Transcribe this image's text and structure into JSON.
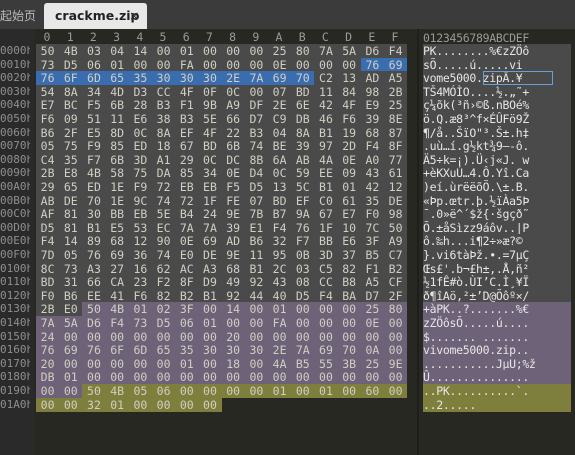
{
  "tabs": {
    "inactive_label": "起始页",
    "active_label": "crackme.zip",
    "close_glyph": "×"
  },
  "column_headers": [
    "0",
    "1",
    "2",
    "3",
    "4",
    "5",
    "6",
    "7",
    "8",
    "9",
    "A",
    "B",
    "C",
    "D",
    "E",
    "F"
  ],
  "ascii_header": "0123456789ABCDEF",
  "rows": [
    {
      "offset": "0000h",
      "hex": [
        "50",
        "4B",
        "03",
        "04",
        "14",
        "00",
        "01",
        "00",
        "00",
        "00",
        "25",
        "80",
        "7A",
        "5A",
        "D6",
        "F4"
      ],
      "ascii": "PK........%€zZÖô"
    },
    {
      "offset": "0010h",
      "hex": [
        "73",
        "D5",
        "06",
        "01",
        "00",
        "00",
        "FA",
        "00",
        "00",
        "00",
        "0E",
        "00",
        "00",
        "00",
        "76",
        "69"
      ],
      "ascii": "sÕ.....ú.....vi"
    },
    {
      "offset": "0020h",
      "hex": [
        "76",
        "6F",
        "6D",
        "65",
        "35",
        "30",
        "30",
        "30",
        "2E",
        "7A",
        "69",
        "70",
        "C2",
        "13",
        "AD",
        "A5"
      ],
      "ascii": "vome5000.zipÂ.­¥"
    },
    {
      "offset": "0030h",
      "hex": [
        "54",
        "8A",
        "34",
        "4D",
        "D3",
        "CC",
        "4F",
        "0F",
        "0C",
        "00",
        "07",
        "BD",
        "11",
        "84",
        "98",
        "2B"
      ],
      "ascii": "TŠ4MÓÌO....½.„˜+"
    },
    {
      "offset": "0040h",
      "hex": [
        "E7",
        "BC",
        "F5",
        "6B",
        "28",
        "B3",
        "F1",
        "9B",
        "A9",
        "DF",
        "2E",
        "6E",
        "42",
        "4F",
        "E9",
        "25"
      ],
      "ascii": "ç¼õk(³ñ›©ß.nBOé%"
    },
    {
      "offset": "0050h",
      "hex": [
        "F6",
        "09",
        "51",
        "11",
        "E6",
        "38",
        "B3",
        "5E",
        "66",
        "D7",
        "C9",
        "DB",
        "46",
        "F6",
        "39",
        "8E"
      ],
      "ascii": "ö.Q.æ8³^f×ÉÛFö9Ž"
    },
    {
      "offset": "0060h",
      "hex": [
        "B6",
        "2F",
        "E5",
        "8D",
        "0C",
        "8A",
        "EF",
        "4F",
        "22",
        "B3",
        "04",
        "8A",
        "B1",
        "19",
        "68",
        "87"
      ],
      "ascii": "¶/å..ŠïO\"³.Š±.h‡"
    },
    {
      "offset": "0070h",
      "hex": [
        "05",
        "75",
        "F9",
        "85",
        "ED",
        "18",
        "67",
        "BD",
        "6B",
        "74",
        "BE",
        "39",
        "97",
        "2D",
        "F4",
        "8F"
      ],
      "ascii": ".uù…í.g½kt¾9—-ô."
    },
    {
      "offset": "0080h",
      "hex": [
        "C4",
        "35",
        "F7",
        "6B",
        "3D",
        "A1",
        "29",
        "0C",
        "DC",
        "8B",
        "6A",
        "AB",
        "4A",
        "0E",
        "A0",
        "77"
      ],
      "ascii": "Ä5÷k=¡).Ü‹j«J. w"
    },
    {
      "offset": "0090h",
      "hex": [
        "2B",
        "E8",
        "4B",
        "58",
        "75",
        "DA",
        "85",
        "34",
        "0E",
        "D4",
        "0C",
        "59",
        "EE",
        "09",
        "43",
        "61"
      ],
      "ascii": "+èKXuÚ…4.Ô.Yî.Ca"
    },
    {
      "offset": "00A0h",
      "hex": [
        "29",
        "65",
        "ED",
        "1E",
        "F9",
        "72",
        "EB",
        "EB",
        "F5",
        "D5",
        "13",
        "5C",
        "B1",
        "01",
        "42",
        "12"
      ],
      "ascii": ")eí.ùrëëõÕ.\\±.B."
    },
    {
      "offset": "00B0h",
      "hex": [
        "AB",
        "DE",
        "70",
        "1E",
        "9C",
        "74",
        "72",
        "1F",
        "FE",
        "07",
        "BD",
        "EF",
        "C0",
        "61",
        "35",
        "DE"
      ],
      "ascii": "«Þp.œtr.þ.½ïÀa5Þ"
    },
    {
      "offset": "00C0h",
      "hex": [
        "AF",
        "81",
        "30",
        "BB",
        "EB",
        "5E",
        "B4",
        "24",
        "9E",
        "7B",
        "B7",
        "9A",
        "67",
        "E7",
        "F0",
        "98"
      ],
      "ascii": "¯.0»ë^´$ž{·šgçð˜"
    },
    {
      "offset": "00D0h",
      "hex": [
        "D5",
        "81",
        "B1",
        "E5",
        "53",
        "EC",
        "7A",
        "7A",
        "39",
        "E1",
        "F4",
        "76",
        "1F",
        "10",
        "7C",
        "50"
      ],
      "ascii": "Õ.±åSìzz9áôv..|P"
    },
    {
      "offset": "00E0h",
      "hex": [
        "F4",
        "14",
        "89",
        "68",
        "12",
        "90",
        "0E",
        "69",
        "AD",
        "B6",
        "32",
        "F7",
        "BB",
        "E6",
        "3F",
        "A9"
      ],
      "ascii": "ô.‰h...i­¶2÷»æ?©"
    },
    {
      "offset": "00F0h",
      "hex": [
        "7D",
        "05",
        "76",
        "69",
        "36",
        "74",
        "E0",
        "DE",
        "9E",
        "11",
        "95",
        "0B",
        "3D",
        "37",
        "B5",
        "C7"
      ],
      "ascii": "}.vi6tàÞž.•.=7µÇ"
    },
    {
      "offset": "0100h",
      "hex": [
        "8C",
        "73",
        "A3",
        "27",
        "16",
        "62",
        "AC",
        "A3",
        "68",
        "B1",
        "2C",
        "03",
        "C5",
        "82",
        "F1",
        "B2"
      ],
      "ascii": "Œs£'.b¬£h±,.Å‚ñ²"
    },
    {
      "offset": "0110h",
      "hex": [
        "BD",
        "31",
        "66",
        "CA",
        "23",
        "F2",
        "8F",
        "D9",
        "49",
        "92",
        "43",
        "08",
        "CC",
        "B8",
        "A5",
        "CF"
      ],
      "ascii": "½1fÊ#ò.ÙI’C.Ì¸¥Ï"
    },
    {
      "offset": "0120h",
      "hex": [
        "F0",
        "B6",
        "EE",
        "41",
        "F6",
        "82",
        "B2",
        "B1",
        "92",
        "44",
        "40",
        "D5",
        "F4",
        "BA",
        "D7",
        "2F"
      ],
      "ascii": "ð¶îAö‚²±’D@Õôº×/"
    },
    {
      "offset": "0130h",
      "hex": [
        "2B",
        "E0",
        "50",
        "4B",
        "01",
        "02",
        "3F",
        "00",
        "14",
        "00",
        "01",
        "00",
        "00",
        "00",
        "25",
        "80"
      ],
      "ascii": "+àPK..?.......%€"
    },
    {
      "offset": "0140h",
      "hex": [
        "7A",
        "5A",
        "D6",
        "F4",
        "73",
        "D5",
        "06",
        "01",
        "00",
        "00",
        "FA",
        "00",
        "00",
        "00",
        "0E",
        "00"
      ],
      "ascii": "zZÖôsÕ.....ú...."
    },
    {
      "offset": "0150h",
      "hex": [
        "24",
        "00",
        "00",
        "00",
        "00",
        "00",
        "00",
        "00",
        "20",
        "00",
        "00",
        "00",
        "00",
        "00",
        "00",
        "00"
      ],
      "ascii": "$....... ......."
    },
    {
      "offset": "0160h",
      "hex": [
        "76",
        "69",
        "76",
        "6F",
        "6D",
        "65",
        "35",
        "30",
        "30",
        "30",
        "2E",
        "7A",
        "69",
        "70",
        "0A",
        "00"
      ],
      "ascii": "vivome5000.zip.."
    },
    {
      "offset": "0170h",
      "hex": [
        "20",
        "00",
        "00",
        "00",
        "00",
        "00",
        "01",
        "00",
        "18",
        "00",
        "4A",
        "B5",
        "55",
        "3B",
        "25",
        "9E"
      ],
      "ascii": " ...........JµU;%ž"
    },
    {
      "offset": "0180h",
      "hex": [
        "DB",
        "01",
        "00",
        "00",
        "00",
        "00",
        "00",
        "00",
        "00",
        "00",
        "00",
        "00",
        "00",
        "00",
        "00",
        "00"
      ],
      "ascii": "Û..............."
    },
    {
      "offset": "0190h",
      "hex": [
        "00",
        "00",
        "50",
        "4B",
        "05",
        "06",
        "00",
        "00",
        "00",
        "00",
        "01",
        "00",
        "01",
        "00",
        "60",
        "00"
      ],
      "ascii": "..PK..........`."
    },
    {
      "offset": "01A0h",
      "hex": [
        "00",
        "00",
        "32",
        "01",
        "00",
        "00",
        "00",
        "00",
        "",
        "",
        "",
        "",
        "",
        "",
        "",
        ""
      ],
      "ascii": "..2....."
    }
  ],
  "colors": {
    "background": "#272822",
    "tag_purple": "#6e6278",
    "tag_gray": "#4a4a4a",
    "tag_blue": "#3a6cb0",
    "tag_olive": "#7f7f3d",
    "selection_outline": "#6a9fd8"
  }
}
